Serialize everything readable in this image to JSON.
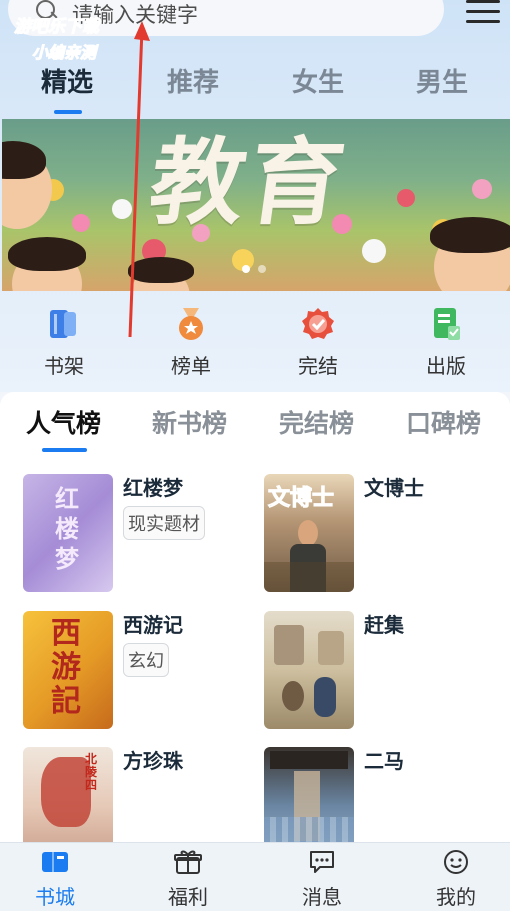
{
  "search": {
    "placeholder": "请输入关键字"
  },
  "watermark": {
    "line1": "游吧乐下载",
    "line2": "小编亲测"
  },
  "top_tabs": [
    {
      "label": "精选",
      "active": true
    },
    {
      "label": "推荐",
      "active": false
    },
    {
      "label": "女生",
      "active": false
    },
    {
      "label": "男生",
      "active": false
    }
  ],
  "banner": {
    "title": "教育",
    "page_count": 2,
    "current_page": 1
  },
  "quick_entries": [
    {
      "label": "书架",
      "icon": "bookshelf-icon",
      "color": "#3d7fe6"
    },
    {
      "label": "榜单",
      "icon": "medal-icon",
      "color": "#f08a3c"
    },
    {
      "label": "完结",
      "icon": "badge-check-icon",
      "color": "#e8503e"
    },
    {
      "label": "出版",
      "icon": "publish-icon",
      "color": "#3fb85f"
    }
  ],
  "rank_tabs": [
    {
      "label": "人气榜",
      "active": true
    },
    {
      "label": "新书榜",
      "active": false
    },
    {
      "label": "完结榜",
      "active": false
    },
    {
      "label": "口碑榜",
      "active": false
    }
  ],
  "books": [
    {
      "title": "红楼梦",
      "tag": "现实题材",
      "cover_text": "红楼梦"
    },
    {
      "title": "文博士",
      "tag": "",
      "cover_text": "文博士"
    },
    {
      "title": "西游记",
      "tag": "玄幻",
      "cover_text": "西游記"
    },
    {
      "title": "赶集",
      "tag": "",
      "cover_text": ""
    },
    {
      "title": "方珍珠",
      "tag": "",
      "cover_text": "北 陵 四"
    },
    {
      "title": "二马",
      "tag": "",
      "cover_text": ""
    }
  ],
  "bottom_nav": [
    {
      "label": "书城",
      "icon": "book-city-icon",
      "active": true
    },
    {
      "label": "福利",
      "icon": "gift-icon",
      "active": false
    },
    {
      "label": "消息",
      "icon": "message-icon",
      "active": false
    },
    {
      "label": "我的",
      "icon": "profile-icon",
      "active": false
    }
  ],
  "colors": {
    "accent": "#1a7cf0",
    "annotation_arrow": "#e23a2e"
  }
}
